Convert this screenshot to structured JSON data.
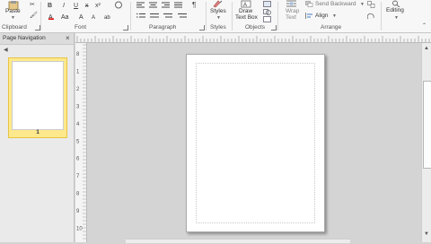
{
  "ribbon": {
    "clipboard": {
      "label": "Clipboard",
      "paste_label": "Paste"
    },
    "font": {
      "label": "Font",
      "bold": "B",
      "italic": "I",
      "underline": "U",
      "strikethrough": "x",
      "superscript": "x²"
    },
    "paragraph": {
      "label": "Paragraph",
      "pilcrow": "¶"
    },
    "styles": {
      "label": "Styles",
      "button_label": "Styles"
    },
    "objects": {
      "label": "Objects",
      "draw_line1": "Draw",
      "draw_line2": "Text Box"
    },
    "arrange": {
      "label": "Arrange",
      "wrap_line1": "Wrap",
      "wrap_line2": "Text",
      "send_backward": "Send Backward",
      "align": "Align"
    },
    "editing": {
      "button_label": "Editing"
    }
  },
  "nav_pane": {
    "title": "Page Navigation",
    "page_number": "1"
  },
  "rulers": {
    "left_numbers": [
      "8",
      "1",
      "2",
      "3",
      "4",
      "5",
      "6",
      "7",
      "8",
      "9",
      "10"
    ]
  },
  "colors": {
    "selected_page": "#fde98c",
    "selected_page_border": "#e8c440",
    "workspace": "#d4d4d4"
  }
}
